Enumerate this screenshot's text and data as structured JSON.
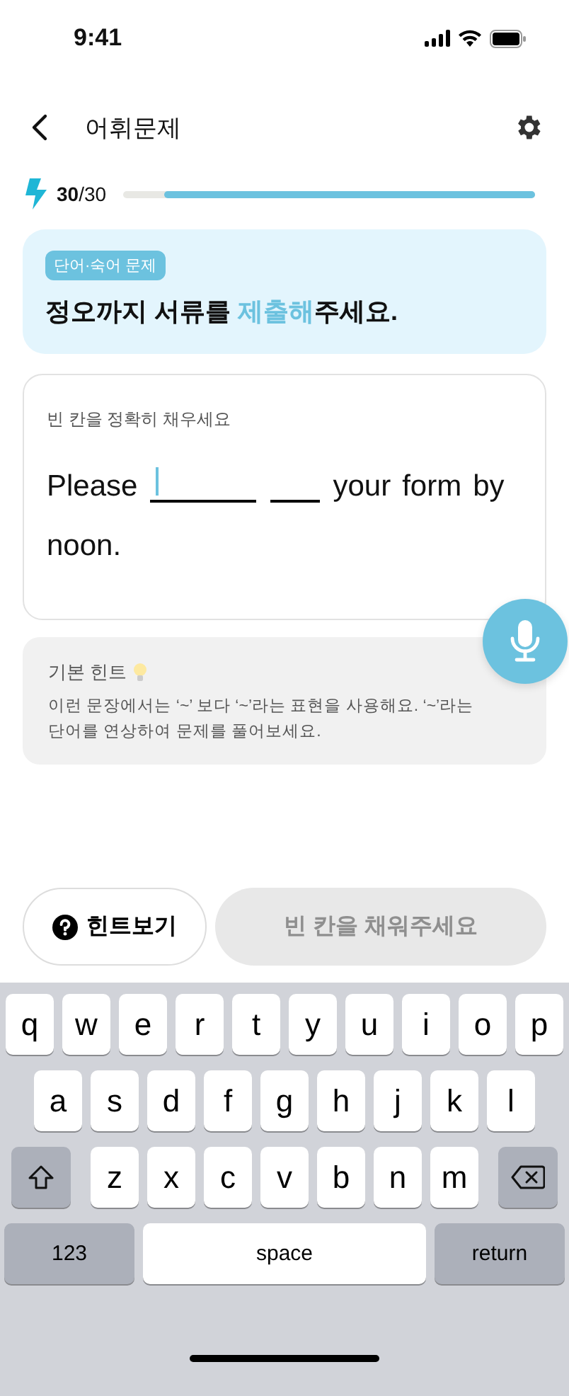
{
  "status_bar": {
    "time": "9:41"
  },
  "header": {
    "title": "어휘문제"
  },
  "progress": {
    "current": "30",
    "total": "/30",
    "level": 0.9
  },
  "question": {
    "tag": "단어·숙어 문제",
    "sentence": "정오까지 서류를 ",
    "highlight": "제출해",
    "sentence_end": "주세요."
  },
  "answer_card": {
    "instruction": "빈 칸을 정확히 채우세요",
    "parts": [
      {
        "kind": "word",
        "text": "Please"
      },
      {
        "kind": "blank",
        "active": true,
        "wide": true
      },
      {
        "kind": "blank",
        "active": false,
        "wide": false
      },
      {
        "kind": "word",
        "text": "your"
      },
      {
        "kind": "word",
        "text": "form"
      },
      {
        "kind": "word",
        "text": "by"
      },
      {
        "kind": "word",
        "text": "noon."
      }
    ]
  },
  "hint": {
    "title": "기본 힌트",
    "text": "이런 문장에서는 ‘~’ 보다  ‘~’라는 표현을 사용해요. ‘~’라는 단어를 연상하여 문제를 풀어보세요."
  },
  "buttons": {
    "hint": "힌트보기",
    "submit": "빈 칸을 채워주세요",
    "submit_disabled": true
  },
  "keyboard": {
    "rows": [
      [
        {
          "kind": "letter",
          "label": "q"
        },
        {
          "kind": "letter",
          "label": "w"
        },
        {
          "kind": "letter",
          "label": "e"
        },
        {
          "kind": "letter",
          "label": "r"
        },
        {
          "kind": "letter",
          "label": "t"
        },
        {
          "kind": "letter",
          "label": "y"
        },
        {
          "kind": "letter",
          "label": "u"
        },
        {
          "kind": "letter",
          "label": "i"
        },
        {
          "kind": "letter",
          "label": "o"
        },
        {
          "kind": "letter",
          "label": "p"
        }
      ],
      [
        {
          "kind": "letter",
          "label": "a"
        },
        {
          "kind": "letter",
          "label": "s"
        },
        {
          "kind": "letter",
          "label": "d"
        },
        {
          "kind": "letter",
          "label": "f"
        },
        {
          "kind": "letter",
          "label": "g"
        },
        {
          "kind": "letter",
          "label": "h"
        },
        {
          "kind": "letter",
          "label": "j"
        },
        {
          "kind": "letter",
          "label": "k"
        },
        {
          "kind": "letter",
          "label": "l"
        }
      ],
      [
        {
          "kind": "shift"
        },
        {
          "kind": "letter",
          "label": "z"
        },
        {
          "kind": "letter",
          "label": "x"
        },
        {
          "kind": "letter",
          "label": "c"
        },
        {
          "kind": "letter",
          "label": "v"
        },
        {
          "kind": "letter",
          "label": "b"
        },
        {
          "kind": "letter",
          "label": "n"
        },
        {
          "kind": "letter",
          "label": "m"
        },
        {
          "kind": "delete"
        }
      ]
    ],
    "bottom_row": {
      "mode_key": "123",
      "space_key": "space",
      "return_key": "return"
    }
  }
}
